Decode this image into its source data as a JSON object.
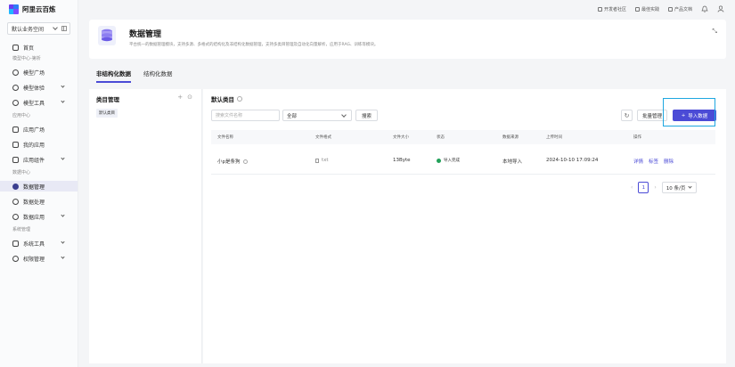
{
  "brand": {
    "name": "阿里云百炼"
  },
  "workspace": {
    "selected": "默认业务空间"
  },
  "sidebar": {
    "home": "首页",
    "groups": [
      {
        "label": "模型中心-第析",
        "items": [
          "模型广场",
          "模型体验",
          "模型工具"
        ]
      },
      {
        "label": "应用中心",
        "items": [
          "应用广场",
          "我的应用",
          "应用组件"
        ]
      },
      {
        "label": "数据中心",
        "items": [
          "数据管理",
          "数据处理",
          "数据应用"
        ]
      },
      {
        "label": "系统管理",
        "items": [
          "系统工具",
          "权限管理"
        ]
      }
    ],
    "active": "数据管理"
  },
  "topbar": {
    "links": [
      "开发者社区",
      "最佳实践",
      "产品文档"
    ],
    "icons": [
      "bell-icon",
      "user-icon"
    ]
  },
  "header": {
    "title": "数据管理",
    "description": "平台统一的数据管理模块，支持多源、多格式的结构化及非结构化数据管理，支持多类目管理及自动化向量解析，应用于RAG、训练等模块。"
  },
  "tabs": [
    "非结构化数据",
    "结构化数据"
  ],
  "active_tab": "非结构化数据",
  "category": {
    "title": "类目管理",
    "items": [
      "默认类目"
    ]
  },
  "main": {
    "title": "默认类目",
    "search_placeholder": "搜索文件名称",
    "filter_value": "全部",
    "search_button": "搜索",
    "batch_button": "批量管理",
    "import_button": "导入数据"
  },
  "table": {
    "columns": [
      "文件名称",
      "文件格式",
      "文件大小",
      "状态",
      "数据来源",
      "上传时间",
      "操作"
    ],
    "rows": [
      {
        "name": "小p是条狗",
        "format": "txt",
        "size": "13Byte",
        "status": "导入完成",
        "source": "本地导入",
        "time": "2024-10-10 17:09:24",
        "actions": [
          "详情",
          "标签",
          "删除"
        ]
      }
    ]
  },
  "pagination": {
    "current": "1",
    "page_size": "10 条/页"
  },
  "colors": {
    "primary": "#4b4bd6",
    "success": "#23a15a",
    "highlight": "#1ea7e0"
  }
}
